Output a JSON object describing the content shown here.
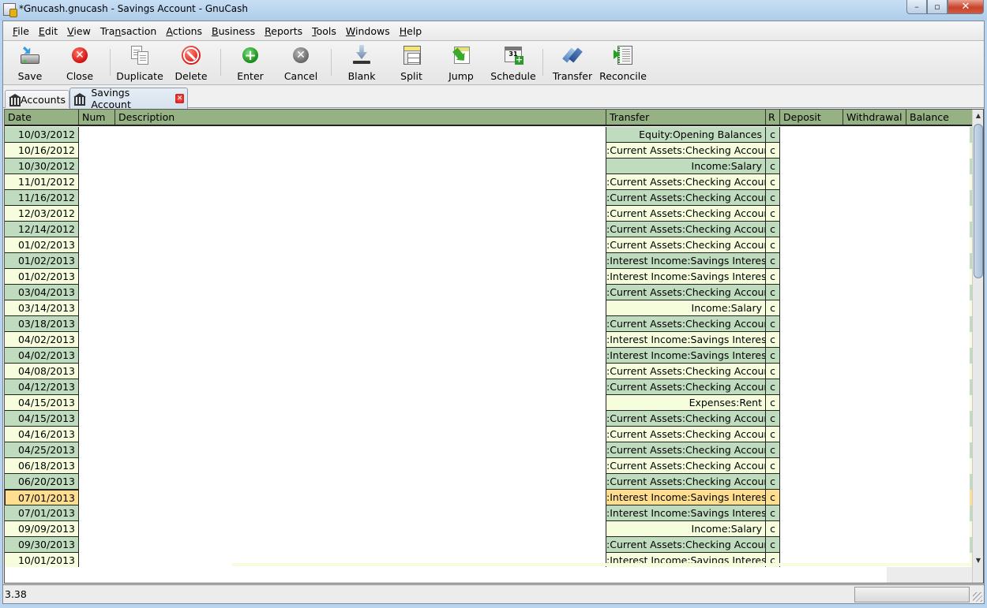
{
  "window": {
    "title": "*Gnucash.gnucash - Savings Account - GnuCash",
    "controls": {
      "minimize": "–",
      "maximize": "▫",
      "close": "✕"
    }
  },
  "menubar": [
    {
      "label": "File",
      "key": "F"
    },
    {
      "label": "Edit",
      "key": "E"
    },
    {
      "label": "View",
      "key": "V"
    },
    {
      "label": "Transaction",
      "key": "n"
    },
    {
      "label": "Actions",
      "key": "A"
    },
    {
      "label": "Business",
      "key": "B"
    },
    {
      "label": "Reports",
      "key": "R"
    },
    {
      "label": "Tools",
      "key": "T"
    },
    {
      "label": "Windows",
      "key": "W"
    },
    {
      "label": "Help",
      "key": "H"
    }
  ],
  "toolbar": {
    "save": {
      "label": "Save",
      "icon": "save-icon"
    },
    "close": {
      "label": "Close",
      "icon": "close-icon"
    },
    "duplicate": {
      "label": "Duplicate",
      "icon": "duplicate-icon"
    },
    "delete": {
      "label": "Delete",
      "icon": "delete-icon"
    },
    "enter": {
      "label": "Enter",
      "icon": "enter-icon"
    },
    "cancel": {
      "label": "Cancel",
      "icon": "cancel-icon"
    },
    "blank": {
      "label": "Blank",
      "icon": "blank-icon"
    },
    "split": {
      "label": "Split",
      "icon": "split-icon"
    },
    "jump": {
      "label": "Jump",
      "icon": "jump-icon"
    },
    "schedule": {
      "label": "Schedule",
      "icon": "schedule-icon",
      "calendar_day": "31"
    },
    "transfer": {
      "label": "Transfer",
      "icon": "transfer-icon"
    },
    "reconcile": {
      "label": "Reconcile",
      "icon": "reconcile-icon"
    }
  },
  "tabs": [
    {
      "label": "Accounts",
      "icon": "bank-icon",
      "active": false
    },
    {
      "label": "Savings Account",
      "icon": "bank-icon",
      "active": true,
      "closable": true
    }
  ],
  "register": {
    "columns": {
      "date": "Date",
      "num": "Num",
      "description": "Description",
      "transfer": "Transfer",
      "r": "R",
      "deposit": "Deposit",
      "withdrawal": "Withdrawal",
      "balance": "Balance"
    },
    "colors": {
      "header": "#96b183",
      "row_green": "#bfdcbf",
      "row_yellow": "#f6fddc",
      "row_selected": "#ffdf8f"
    },
    "rows": [
      {
        "date": "10/03/2012",
        "num": "",
        "description": "",
        "transfer": "Equity:Opening Balances",
        "r": "c",
        "deposit": "",
        "withdrawal": "",
        "balance": "",
        "style": "green"
      },
      {
        "date": "10/16/2012",
        "num": "",
        "description": "",
        "transfer": ":Current Assets:Checking Account",
        "r": "c",
        "deposit": "",
        "withdrawal": "",
        "balance": "",
        "style": "yellow"
      },
      {
        "date": "10/30/2012",
        "num": "",
        "description": "",
        "transfer": "Income:Salary",
        "r": "c",
        "deposit": "",
        "withdrawal": "",
        "balance": "",
        "style": "green"
      },
      {
        "date": "11/01/2012",
        "num": "",
        "description": "",
        "transfer": ":Current Assets:Checking Account",
        "r": "c",
        "deposit": "",
        "withdrawal": "",
        "balance": "",
        "style": "yellow"
      },
      {
        "date": "11/16/2012",
        "num": "",
        "description": "",
        "transfer": ":Current Assets:Checking Account",
        "r": "c",
        "deposit": "",
        "withdrawal": "",
        "balance": "",
        "style": "green"
      },
      {
        "date": "12/03/2012",
        "num": "",
        "description": "",
        "transfer": ":Current Assets:Checking Account",
        "r": "c",
        "deposit": "",
        "withdrawal": "",
        "balance": "",
        "style": "yellow"
      },
      {
        "date": "12/14/2012",
        "num": "",
        "description": "",
        "transfer": ":Current Assets:Checking Account",
        "r": "c",
        "deposit": "",
        "withdrawal": "",
        "balance": "",
        "style": "green"
      },
      {
        "date": "01/02/2013",
        "num": "",
        "description": "",
        "transfer": ":Current Assets:Checking Account",
        "r": "c",
        "deposit": "",
        "withdrawal": "",
        "balance": "",
        "style": "yellow"
      },
      {
        "date": "01/02/2013",
        "num": "",
        "description": "",
        "transfer": ":Interest Income:Savings Interest",
        "r": "c",
        "deposit": "",
        "withdrawal": "",
        "balance": "",
        "style": "green"
      },
      {
        "date": "01/02/2013",
        "num": "",
        "description": "",
        "transfer": ":Interest Income:Savings Interest",
        "r": "c",
        "deposit": "",
        "withdrawal": "",
        "balance": "",
        "style": "yellow"
      },
      {
        "date": "03/04/2013",
        "num": "",
        "description": "",
        "transfer": ":Current Assets:Checking Account",
        "r": "c",
        "deposit": "",
        "withdrawal": "",
        "balance": "",
        "style": "green"
      },
      {
        "date": "03/14/2013",
        "num": "",
        "description": "",
        "transfer": "Income:Salary",
        "r": "c",
        "deposit": "",
        "withdrawal": "",
        "balance": "",
        "style": "yellow"
      },
      {
        "date": "03/18/2013",
        "num": "",
        "description": "",
        "transfer": ":Current Assets:Checking Account",
        "r": "c",
        "deposit": "",
        "withdrawal": "",
        "balance": "",
        "style": "green"
      },
      {
        "date": "04/02/2013",
        "num": "",
        "description": "",
        "transfer": ":Interest Income:Savings Interest",
        "r": "c",
        "deposit": "",
        "withdrawal": "",
        "balance": "",
        "style": "yellow"
      },
      {
        "date": "04/02/2013",
        "num": "",
        "description": "",
        "transfer": ":Interest Income:Savings Interest",
        "r": "c",
        "deposit": "",
        "withdrawal": "",
        "balance": "",
        "style": "green"
      },
      {
        "date": "04/08/2013",
        "num": "",
        "description": "",
        "transfer": ":Current Assets:Checking Account",
        "r": "c",
        "deposit": "",
        "withdrawal": "",
        "balance": "",
        "style": "yellow"
      },
      {
        "date": "04/12/2013",
        "num": "",
        "description": "",
        "transfer": ":Current Assets:Checking Account",
        "r": "c",
        "deposit": "",
        "withdrawal": "",
        "balance": "",
        "style": "green"
      },
      {
        "date": "04/15/2013",
        "num": "",
        "description": "",
        "transfer": "Expenses:Rent",
        "r": "c",
        "deposit": "",
        "withdrawal": "",
        "balance": "",
        "style": "yellow"
      },
      {
        "date": "04/15/2013",
        "num": "",
        "description": "",
        "transfer": ":Current Assets:Checking Account",
        "r": "c",
        "deposit": "",
        "withdrawal": "",
        "balance": "",
        "style": "green"
      },
      {
        "date": "04/16/2013",
        "num": "",
        "description": "",
        "transfer": ":Current Assets:Checking Account",
        "r": "c",
        "deposit": "",
        "withdrawal": "",
        "balance": "",
        "style": "yellow"
      },
      {
        "date": "04/25/2013",
        "num": "",
        "description": "",
        "transfer": ":Current Assets:Checking Account",
        "r": "c",
        "deposit": "",
        "withdrawal": "",
        "balance": "",
        "style": "green"
      },
      {
        "date": "06/18/2013",
        "num": "",
        "description": "",
        "transfer": ":Current Assets:Checking Account",
        "r": "c",
        "deposit": "",
        "withdrawal": "",
        "balance": "",
        "style": "yellow"
      },
      {
        "date": "06/20/2013",
        "num": "",
        "description": "",
        "transfer": ":Current Assets:Checking Account",
        "r": "c",
        "deposit": "",
        "withdrawal": "",
        "balance": "",
        "style": "green"
      },
      {
        "date": "07/01/2013",
        "num": "",
        "description": "",
        "transfer": ":Interest Income:Savings Interest",
        "r": "c",
        "deposit": "",
        "withdrawal": "",
        "balance": "",
        "style": "selected"
      },
      {
        "date": "07/01/2013",
        "num": "",
        "description": "",
        "transfer": ":Interest Income:Savings Interest",
        "r": "c",
        "deposit": "",
        "withdrawal": "",
        "balance": "",
        "style": "green"
      },
      {
        "date": "09/09/2013",
        "num": "",
        "description": "",
        "transfer": "Income:Salary",
        "r": "c",
        "deposit": "",
        "withdrawal": "",
        "balance": "",
        "style": "yellow"
      },
      {
        "date": "09/30/2013",
        "num": "",
        "description": "",
        "transfer": ":Current Assets:Checking Account",
        "r": "c",
        "deposit": "",
        "withdrawal": "",
        "balance": "",
        "style": "green"
      },
      {
        "date": "10/01/2013",
        "num": "",
        "description": "",
        "transfer": ":Interest Income:Savings Interest",
        "r": "c",
        "deposit": "",
        "withdrawal": "",
        "balance": "",
        "style": "yellow"
      }
    ]
  },
  "scrollbar": {
    "up": "▲",
    "down": "▼"
  },
  "statusbar": {
    "text": "3.38"
  }
}
